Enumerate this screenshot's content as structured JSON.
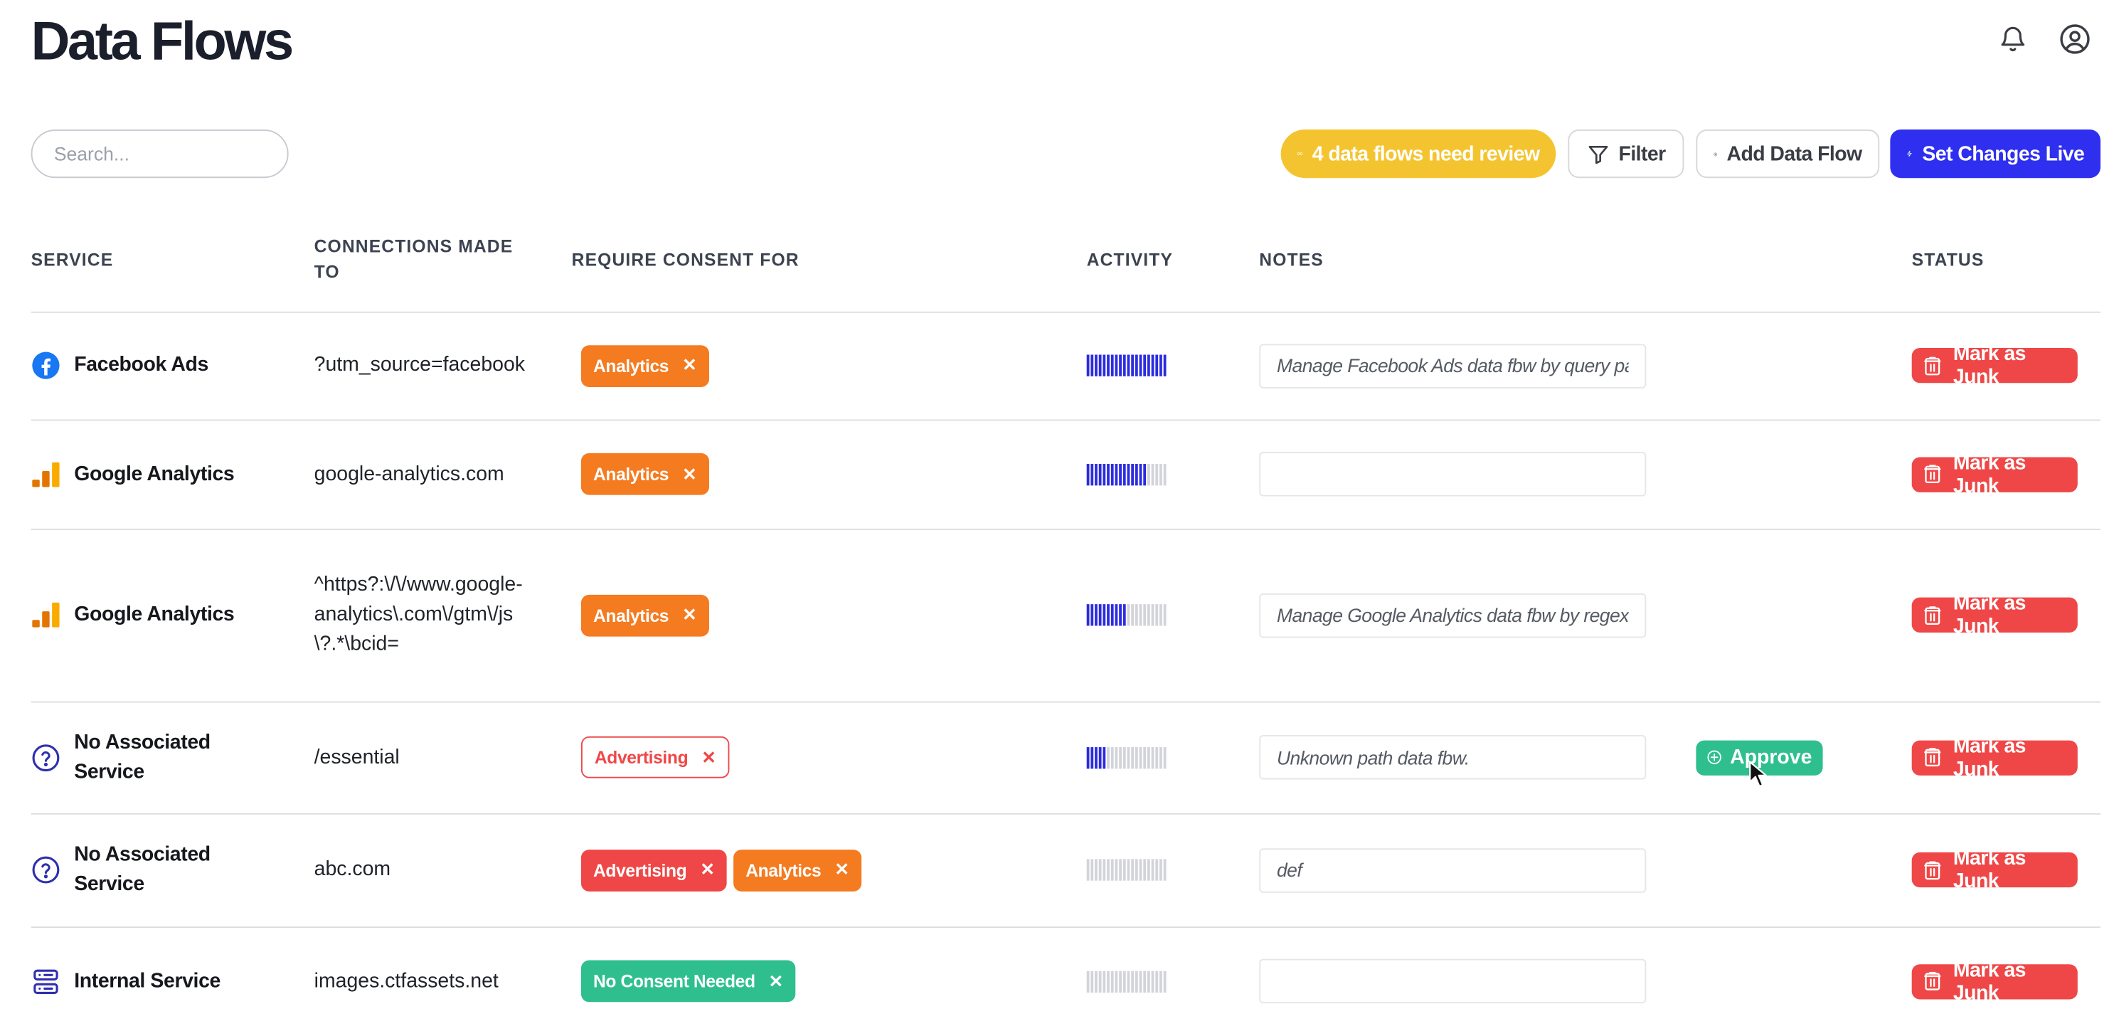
{
  "page": {
    "title": "Data Flows"
  },
  "header": {
    "bell_icon": "bell-icon",
    "account_icon": "user-circle-icon"
  },
  "search": {
    "placeholder": "Search..."
  },
  "toolbar": {
    "review_label": "4 data flows need review",
    "filter_label": "Filter",
    "add_label": "Add Data Flow",
    "live_label": "Set Changes Live"
  },
  "colors": {
    "review": "#f4c430",
    "primary": "#2f2ff0",
    "analytics": "#f47b20",
    "advertising": "#ef4747",
    "no_consent": "#2fbf8f",
    "junk": "#ef4747",
    "approve": "#2fbf8f",
    "activity_on": "#2b2be0",
    "activity_off": "#d2d4d9"
  },
  "table": {
    "headers": {
      "service": "SERVICE",
      "connections": "CONNECTIONS MADE TO",
      "consent": "REQUIRE CONSENT FOR",
      "activity": "ACTIVITY",
      "notes": "NOTES",
      "status": "STATUS"
    },
    "rows": [
      {
        "service": "Facebook Ads",
        "icon": "facebook-icon",
        "connection": "?utm_source=facebook",
        "tags": [
          {
            "label": "Analytics",
            "kind": "analytics"
          }
        ],
        "activity": 20,
        "note": "Manage Facebook Ads data fbw by query par",
        "approve": null,
        "junk": "Mark as Junk"
      },
      {
        "service": "Google Analytics",
        "icon": "google-analytics-icon",
        "connection": "google-analytics.com",
        "tags": [
          {
            "label": "Analytics",
            "kind": "analytics"
          }
        ],
        "activity": 15,
        "note": "",
        "approve": null,
        "junk": "Mark as Junk"
      },
      {
        "service": "Google Analytics",
        "icon": "google-analytics-icon",
        "connection": "^https?:\\/\\/www.google-analytics\\.com\\/gtm\\/js\\?.*\\bcid=",
        "tags": [
          {
            "label": "Analytics",
            "kind": "analytics"
          }
        ],
        "activity": 10,
        "note": "Manage Google Analytics data fbw by regex",
        "approve": null,
        "junk": "Mark as Junk"
      },
      {
        "service": "No Associated Service",
        "icon": "question-circle-icon",
        "connection": "/essential",
        "tags": [
          {
            "label": "Advertising",
            "kind": "advertising-outline"
          }
        ],
        "activity": 5,
        "note": "Unknown path data fbw.",
        "approve": "Approve",
        "junk": "Mark as Junk"
      },
      {
        "service": "No Associated Service",
        "icon": "question-circle-icon",
        "connection": "abc.com",
        "tags": [
          {
            "label": "Advertising",
            "kind": "advertising"
          },
          {
            "label": "Analytics",
            "kind": "analytics"
          }
        ],
        "activity": 0,
        "note": "def",
        "approve": null,
        "junk": "Mark as Junk"
      },
      {
        "service": "Internal Service",
        "icon": "server-icon",
        "connection": "images.ctfassets.net",
        "tags": [
          {
            "label": "No Consent Needed",
            "kind": "noconsent"
          }
        ],
        "activity": 0,
        "note": "",
        "approve": null,
        "junk": "Mark as Junk"
      }
    ]
  }
}
